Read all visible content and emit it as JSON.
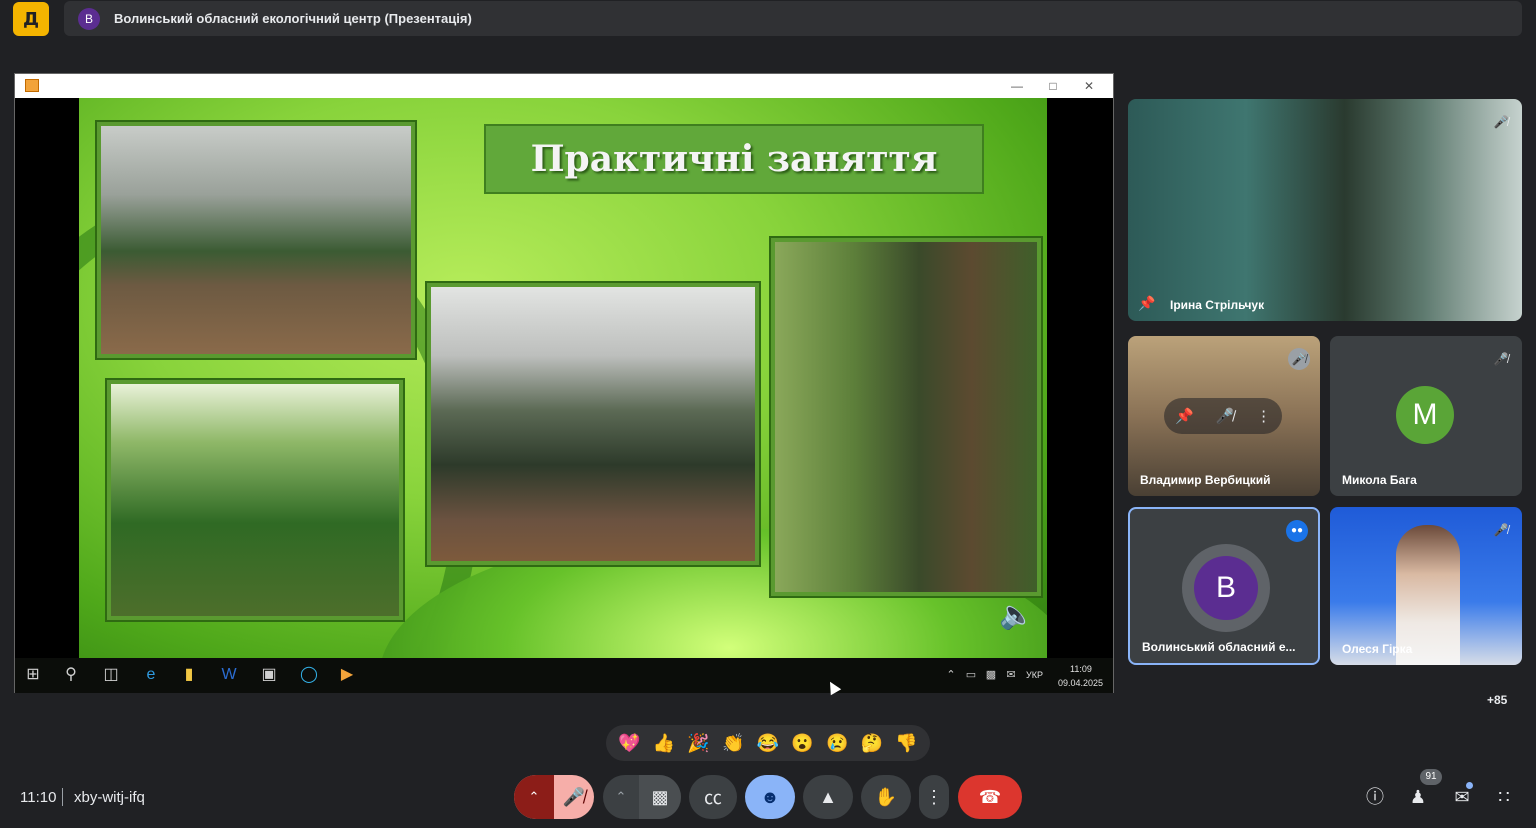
{
  "top_bar": {
    "app_logo": "Д",
    "presenter_initial": "В",
    "presentation_title": "Волинський обласний екологічний центр (Презентація)"
  },
  "slide": {
    "title": "Практичні заняття"
  },
  "windows_taskbar": {
    "language": "УКР",
    "time": "11:09",
    "date": "09.04.2025"
  },
  "participants": [
    {
      "name": "Ірина Стрільчук",
      "muted": true
    },
    {
      "name": "Владимир Вербицкий",
      "muted": true
    },
    {
      "name": "Микола Бага",
      "initial": "M",
      "avatar_color": "#5aa537",
      "muted": true
    },
    {
      "name": "Волинський обласний е...",
      "initial": "B",
      "avatar_color": "#5b2d91",
      "speaking": true
    },
    {
      "name": "Олеся Гірка",
      "muted": true
    }
  ],
  "more_participants": "+85",
  "reactions": [
    "💖",
    "👍",
    "🎉",
    "👏",
    "😂",
    "😮",
    "😢",
    "🤔",
    "👎"
  ],
  "meeting": {
    "time": "11:10",
    "code": "xby-witj-ifq",
    "people_count": "91"
  },
  "colors": {
    "accent_blue": "#8ab4f8",
    "leave_red": "#dc362e",
    "mic_off_bg": "#f6aea9"
  }
}
